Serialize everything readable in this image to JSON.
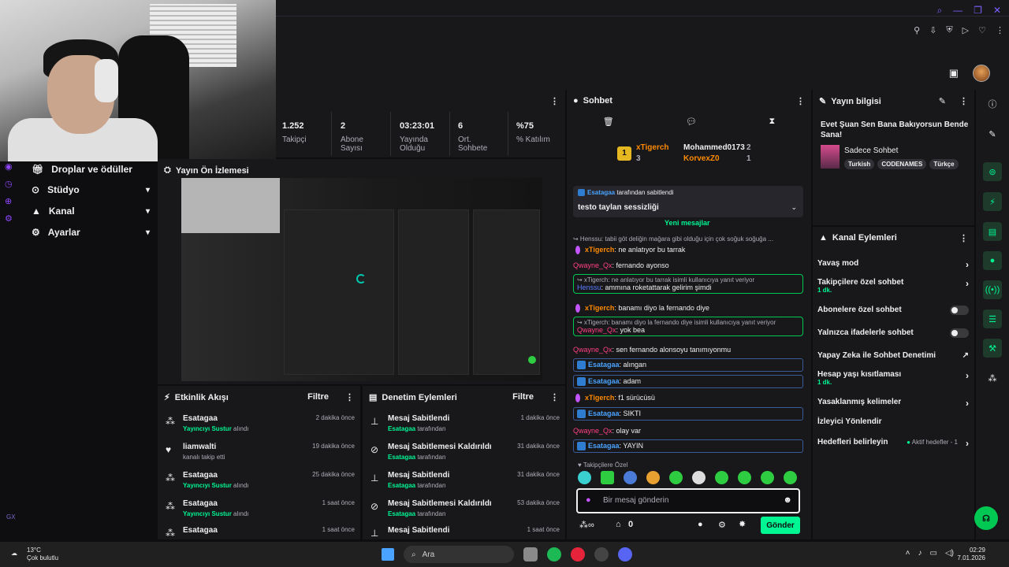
{
  "stats": [
    {
      "value": "1.252",
      "label1": "Takipçi",
      "label2": ""
    },
    {
      "value": "2",
      "label1": "Abone",
      "label2": "Sayısı"
    },
    {
      "value": "03:23:01",
      "label1": "Yayında",
      "label2": "Olduğu"
    },
    {
      "value": "6",
      "label1": "Ort.",
      "label2": "Sohbete"
    },
    {
      "value": "%75",
      "label1": "% Katılım",
      "label2": ""
    }
  ],
  "sidebar": {
    "items": [
      {
        "label": "Droplar ve ödüller"
      },
      {
        "label": "Stüdyo"
      },
      {
        "label": "Kanal"
      },
      {
        "label": "Ayarlar"
      }
    ],
    "gx": "GX"
  },
  "preview": {
    "title": "Yayın Ön İzlemesi"
  },
  "activity": {
    "title": "Etkinlik Akışı",
    "filter": "Filtre",
    "items": [
      {
        "user": "Esatagaa",
        "action_hl": "Yayıncıyı Sustur",
        "action": "alındı",
        "time": "2 dakika önce"
      },
      {
        "user": "liamwalti",
        "action_hl": "",
        "action": "kanalı takip etti",
        "time": "19 dakika önce"
      },
      {
        "user": "Esatagaa",
        "action_hl": "Yayıncıyı Sustur",
        "action": "alındı",
        "time": "25 dakika önce"
      },
      {
        "user": "Esatagaa",
        "action_hl": "Yayıncıyı Sustur",
        "action": "alındı",
        "time": "1 saat önce"
      },
      {
        "user": "Esatagaa",
        "action_hl": "",
        "action": "",
        "time": "1 saat önce"
      }
    ]
  },
  "moderation": {
    "title": "Denetim Eylemleri",
    "filter": "Filtre",
    "items": [
      {
        "title": "Mesaj Sabitlendi",
        "user": "Esatagaa",
        "by": "tarafından",
        "time": "1 dakika önce"
      },
      {
        "title": "Mesaj Sabitlemesi Kaldırıldı",
        "user": "Esatagaa",
        "by": "tarafından",
        "time": "31 dakika önce"
      },
      {
        "title": "Mesaj Sabitlendi",
        "user": "Esatagaa",
        "by": "tarafından",
        "time": "31 dakika önce"
      },
      {
        "title": "Mesaj Sabitlemesi Kaldırıldı",
        "user": "Esatagaa",
        "by": "tarafından",
        "time": "53 dakika önce"
      },
      {
        "title": "Mesaj Sabitlendi",
        "user": "",
        "by": "",
        "time": "1 saat önce"
      }
    ]
  },
  "chat": {
    "title": "Sohbet",
    "leaders": {
      "first_name": "xTigerch",
      "first_count": "3",
      "second_name": "Mohammed0173",
      "second_count": "2",
      "third_name": "KorvexZ0",
      "third_count": "1"
    },
    "pinned_by_user": "Esatagaa",
    "pinned_by_text": "tarafından sabitlendi",
    "pinned_text": "testo taylan sessizliği",
    "new_messages": "Yeni mesajlar",
    "messages": [
      {
        "reply": "↪ Henssu: tabii göt deliğin mağara gibi olduğu için çok soğuk soğuğa ..."
      },
      {
        "user": "xTigerch",
        "text": ": ne anlatıyor bu tarrak"
      },
      {
        "user": "Qwayne_Qx",
        "text": ": fernando ayonso"
      },
      {
        "reply": "↪ xTigerch: ne anlatıyor bu tarrak isimli kullanıcıya yanıt veriyor",
        "user": "Henssu",
        "text": ": ammına roketattarak gelirim şimdi"
      },
      {
        "user": "xTigerch",
        "text": ": banamı diyo la fernando diye"
      },
      {
        "reply": "↪ xTigerch: banamı diyo la fernando diye isimli kullanıcıya yanıt veriyor",
        "user": "Qwayne_Qx",
        "text": ": yok bea"
      },
      {
        "user": "Qwayne_Qx",
        "text": ": sen fernando alonsoyu tanımıyonmu"
      },
      {
        "user": "Esatagaa",
        "text": ": alıngan"
      },
      {
        "user": "Esatagaa",
        "text": ": adam"
      },
      {
        "user": "xTigerch",
        "text": ": f1 sürücüsü"
      },
      {
        "user": "Esatagaa",
        "text": ": SIKTI"
      },
      {
        "user": "Qwayne_Qx",
        "text": ": olay var"
      },
      {
        "user": "Esatagaa",
        "text": ": YAYIN"
      }
    ],
    "followers_only": "Takipçilere Özel",
    "input_placeholder": "Bir mesaj gönderin",
    "points": "0",
    "send": "Gönder"
  },
  "info": {
    "title": "Yayın bilgisi",
    "stream_title": "Evet Şuan Sen Bana Bakıyorsun Bende Sana!",
    "category": "Sadece Sohbet",
    "tags": [
      "Turkish",
      "CODENAMES",
      "Türkçe"
    ]
  },
  "actions": {
    "title": "Kanal Eylemleri",
    "slow": "Yavaş mod",
    "followers": "Takipçilere özel sohbet",
    "followers_sub": "1 dk.",
    "subs": "Abonelere özel sohbet",
    "emote": "Yalnızca ifadelerle sohbet",
    "ai": "Yapay Zeka ile Sohbet Denetimi",
    "age": "Hesap yaşı kısıtlaması",
    "age_sub": "1 dk.",
    "banned": "Yasaklanmış kelimeler",
    "raid": "İzleyici Yönlendir",
    "goals": "Hedefleri belirleyin",
    "goals_status": "Aktif hedefler - 1"
  },
  "taskbar": {
    "temp": "13°C",
    "weather": "Çok bulutlu",
    "search": "Ara",
    "time": "02:29",
    "date": "7.01.2026"
  },
  "colors": {
    "accent": "#00f593",
    "purple": "#9147ff",
    "bg": "#0e0e10",
    "panel": "#18181b"
  }
}
